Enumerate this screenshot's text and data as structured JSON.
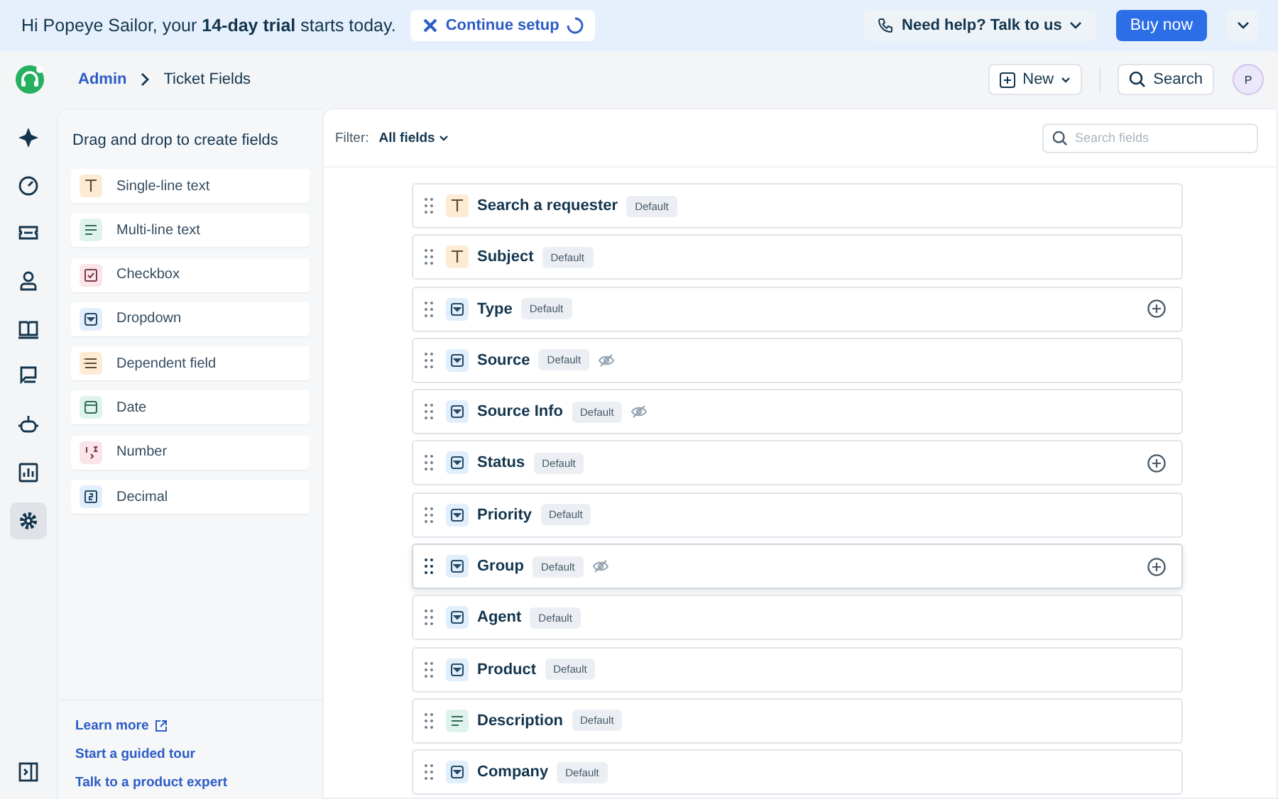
{
  "banner": {
    "greeting": "Hi Popeye Sailor, your **14-day trial** starts today.",
    "setup_button": "Continue setup",
    "help_button": "Need help? Talk to us",
    "buy_button": "Buy now"
  },
  "header": {
    "breadcrumb": [
      "Admin",
      "Ticket Fields"
    ],
    "new_button": "New",
    "search_button": "Search",
    "avatar": "P"
  },
  "rail": [
    {
      "selected": false
    },
    {
      "selected": false
    },
    {
      "selected": false
    },
    {
      "selected": false
    },
    {
      "selected": false
    },
    {
      "selected": false
    },
    {
      "selected": false
    },
    {
      "selected": false
    },
    {
      "selected": true
    }
  ],
  "palette": {
    "title": "Drag and drop to create fields",
    "items": [
      {
        "kind": "text",
        "label": "Single-line text"
      },
      {
        "kind": "paragraph",
        "label": "Multi-line text"
      },
      {
        "kind": "checkbox",
        "label": "Checkbox"
      },
      {
        "kind": "dropdown",
        "label": "Dropdown"
      },
      {
        "kind": "dependent",
        "label": "Dependent field"
      },
      {
        "kind": "date",
        "label": "Date"
      },
      {
        "kind": "number",
        "label": "Number"
      },
      {
        "kind": "decimal",
        "label": "Decimal"
      }
    ],
    "links": [
      "Learn more",
      "Start a guided tour",
      "Talk to a product expert"
    ]
  },
  "filter": {
    "label": "Filter:",
    "value": "All fields",
    "search_placeholder": "Search fields"
  },
  "fields": [
    {
      "kind": "text",
      "name": "Search a requester",
      "badge": "Default",
      "hidden": false,
      "addable": false,
      "highlighted": false
    },
    {
      "kind": "text",
      "name": "Subject",
      "badge": "Default",
      "hidden": false,
      "addable": false,
      "highlighted": false
    },
    {
      "kind": "dropdown",
      "name": "Type",
      "badge": "Default",
      "hidden": false,
      "addable": true,
      "highlighted": false
    },
    {
      "kind": "dropdown",
      "name": "Source",
      "badge": "Default",
      "hidden": true,
      "addable": false,
      "highlighted": false
    },
    {
      "kind": "dropdown",
      "name": "Source Info",
      "badge": "Default",
      "hidden": true,
      "addable": false,
      "highlighted": false
    },
    {
      "kind": "dropdown",
      "name": "Status",
      "badge": "Default",
      "hidden": false,
      "addable": true,
      "highlighted": false
    },
    {
      "kind": "dropdown",
      "name": "Priority",
      "badge": "Default",
      "hidden": false,
      "addable": false,
      "highlighted": false
    },
    {
      "kind": "dropdown",
      "name": "Group",
      "badge": "Default",
      "hidden": true,
      "addable": true,
      "highlighted": true
    },
    {
      "kind": "dropdown",
      "name": "Agent",
      "badge": "Default",
      "hidden": false,
      "addable": false,
      "highlighted": false
    },
    {
      "kind": "dropdown",
      "name": "Product",
      "badge": "Default",
      "hidden": false,
      "addable": false,
      "highlighted": false
    },
    {
      "kind": "paragraph",
      "name": "Description",
      "badge": "Default",
      "hidden": false,
      "addable": false,
      "highlighted": false
    },
    {
      "kind": "dropdown",
      "name": "Company",
      "badge": "Default",
      "hidden": false,
      "addable": false,
      "highlighted": false
    }
  ]
}
